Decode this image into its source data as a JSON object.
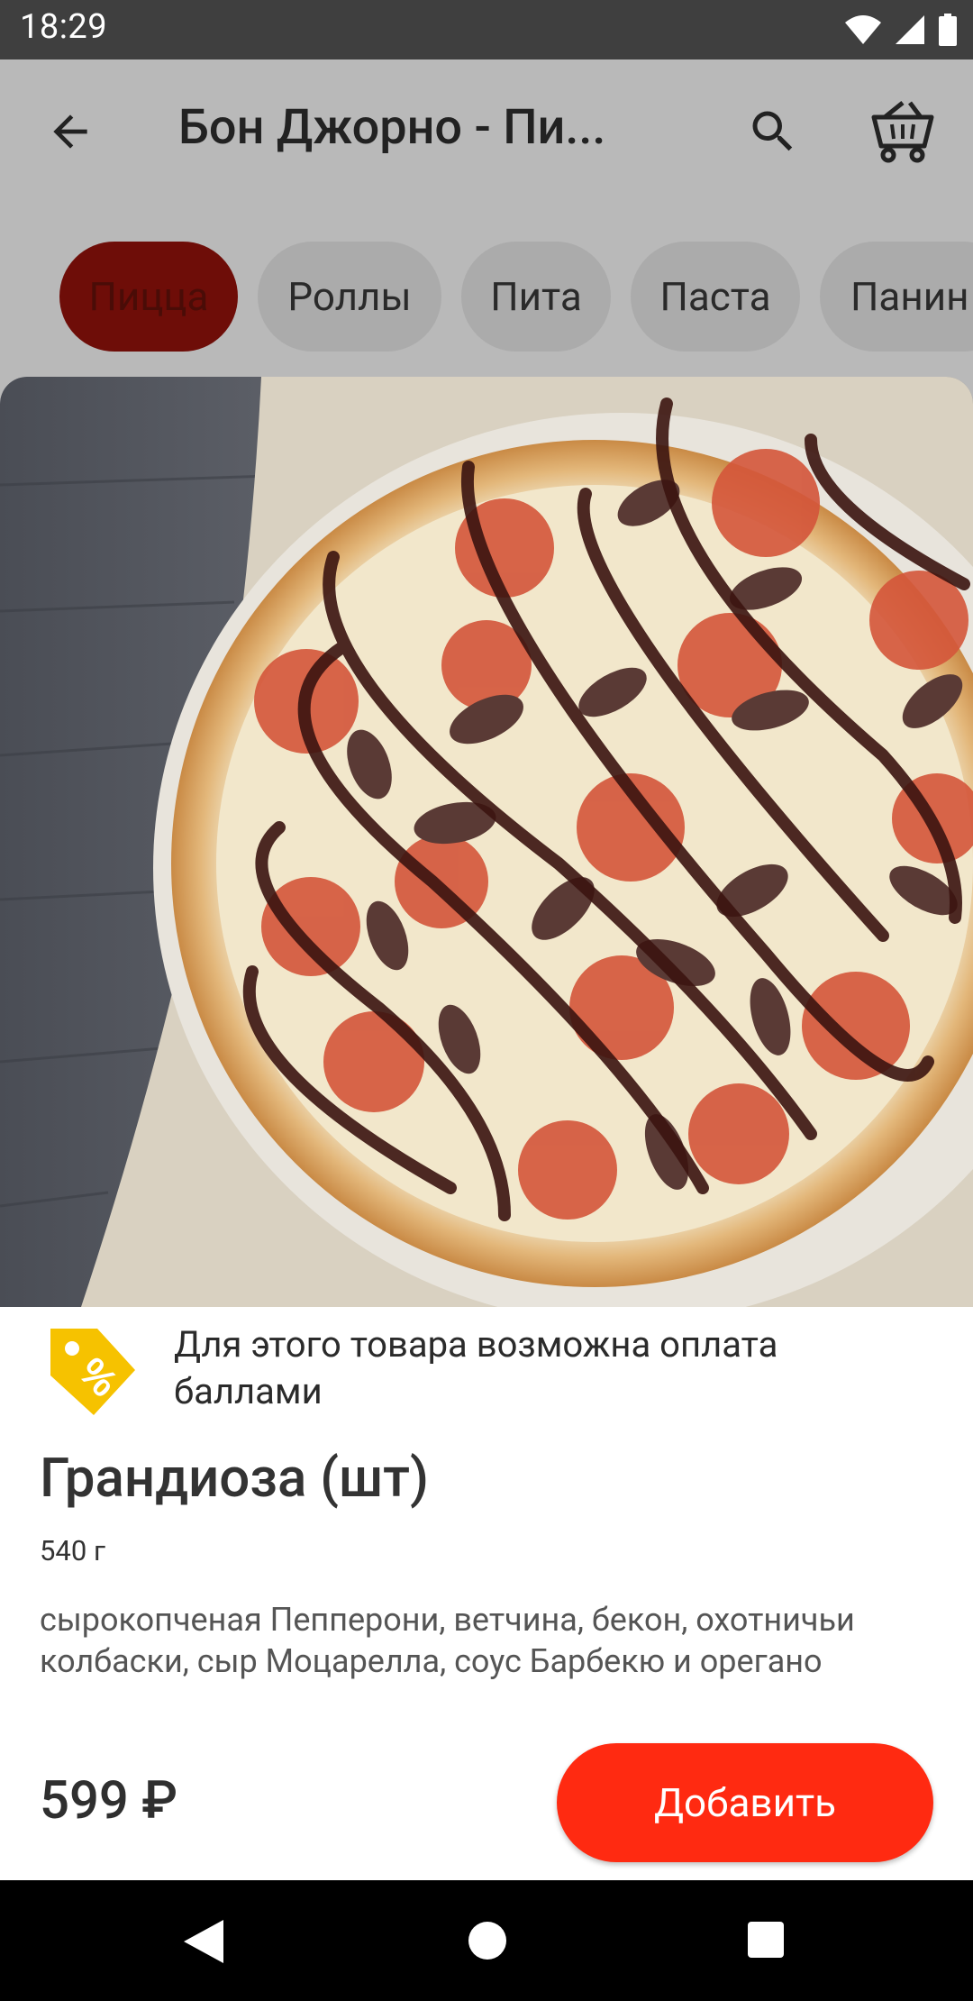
{
  "status_bar": {
    "time": "18:29"
  },
  "app_bar": {
    "title": "Бон Джорно - Пи..."
  },
  "categories": [
    {
      "label": "Пицца",
      "active": true
    },
    {
      "label": "Роллы",
      "active": false
    },
    {
      "label": "Пита",
      "active": false
    },
    {
      "label": "Паста",
      "active": false
    },
    {
      "label": "Панин",
      "active": false
    }
  ],
  "product": {
    "points_note": "Для этого товара возможна оплата баллами",
    "title": "Грандиоза (шт)",
    "weight": "540 г",
    "description": "сырокопченая Пепперони, ветчина, бекон, охотничьи колбаски,  сыр Моцарелла, соус Барбекю и орегано",
    "price": "599 ₽",
    "add_button_label": "Добавить"
  },
  "colors": {
    "accent_red": "#ff2a11",
    "active_chip": "#6e0d08",
    "points_badge": "#f6c200"
  }
}
